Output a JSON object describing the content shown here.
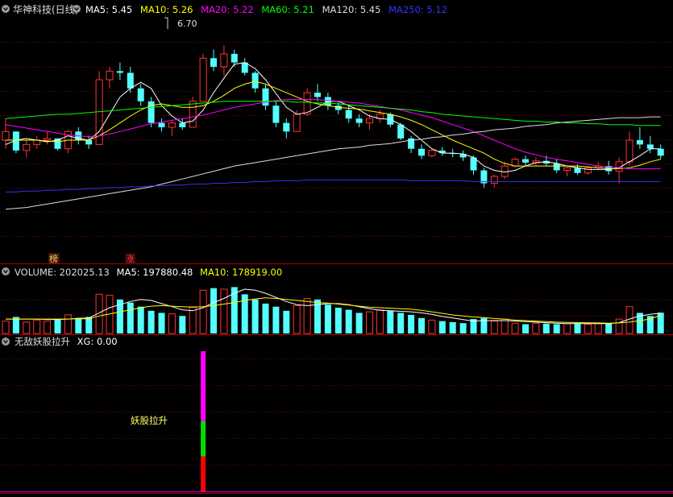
{
  "main": {
    "stock_title": "华神科技(日线)",
    "ma_labels": [
      {
        "text": "MA5: 5.45",
        "color": "#ffffff"
      },
      {
        "text": "MA10: 5.26",
        "color": "#ffff00"
      },
      {
        "text": "MA20: 5.22",
        "color": "#ff00ff"
      },
      {
        "text": "MA60: 5.21",
        "color": "#00ff00"
      },
      {
        "text": "MA120: 5.45",
        "color": "#dddddd"
      },
      {
        "text": "MA250: 5.12",
        "color": "#3333ff"
      }
    ],
    "high_label": "6.70",
    "markers": [
      {
        "text": "榜",
        "color": "#ffcc66"
      },
      {
        "text": "涨",
        "color": "#ff4444"
      }
    ]
  },
  "volume": {
    "labels": [
      {
        "text": "VOLUME: 202025.13",
        "color": "#dddddd"
      },
      {
        "text": "MA5: 197880.48",
        "color": "#ffffff"
      },
      {
        "text": "MA10: 178919.00",
        "color": "#ffff00"
      }
    ]
  },
  "indicator": {
    "labels": [
      {
        "text": "无敌妖股拉升",
        "color": "#dddddd"
      },
      {
        "text": "XG: 0.00",
        "color": "#ffffff"
      }
    ],
    "signal_text": "妖股拉升"
  },
  "colors": {
    "up": "#ff3333",
    "down": "#54ffff",
    "grid": "#8b0000",
    "border": "#aa0000"
  },
  "chart_data": [
    {
      "type": "candlestick",
      "title": "华神科技(日线)",
      "y_range": [
        4.2,
        7.0
      ],
      "candles": [
        [
          5.6,
          5.85,
          5.5,
          5.7
        ],
        [
          5.7,
          5.7,
          5.45,
          5.48
        ],
        [
          5.48,
          5.6,
          5.4,
          5.55
        ],
        [
          5.55,
          5.65,
          5.5,
          5.6
        ],
        [
          5.6,
          5.7,
          5.55,
          5.62
        ],
        [
          5.62,
          5.62,
          5.48,
          5.5
        ],
        [
          5.5,
          5.72,
          5.45,
          5.7
        ],
        [
          5.7,
          5.75,
          5.55,
          5.6
        ],
        [
          5.6,
          5.65,
          5.5,
          5.55
        ],
        [
          5.55,
          6.4,
          5.55,
          6.3
        ],
        [
          6.3,
          6.45,
          6.2,
          6.4
        ],
        [
          6.4,
          6.5,
          6.3,
          6.38
        ],
        [
          6.38,
          6.45,
          6.15,
          6.2
        ],
        [
          6.2,
          6.25,
          6.0,
          6.05
        ],
        [
          6.05,
          6.1,
          5.75,
          5.8
        ],
        [
          5.8,
          5.85,
          5.7,
          5.75
        ],
        [
          5.75,
          5.82,
          5.65,
          5.8
        ],
        [
          5.8,
          5.85,
          5.72,
          5.75
        ],
        [
          5.75,
          6.1,
          5.75,
          6.05
        ],
        [
          6.05,
          6.6,
          6.05,
          6.55
        ],
        [
          6.55,
          6.65,
          6.4,
          6.45
        ],
        [
          6.45,
          6.7,
          6.35,
          6.6
        ],
        [
          6.6,
          6.65,
          6.45,
          6.5
        ],
        [
          6.5,
          6.55,
          6.35,
          6.38
        ],
        [
          6.38,
          6.4,
          6.15,
          6.2
        ],
        [
          6.2,
          6.25,
          5.95,
          6.0
        ],
        [
          6.0,
          6.05,
          5.75,
          5.8
        ],
        [
          5.8,
          5.85,
          5.62,
          5.7
        ],
        [
          5.7,
          5.95,
          5.7,
          5.9
        ],
        [
          5.9,
          6.2,
          5.88,
          6.15
        ],
        [
          6.15,
          6.25,
          6.05,
          6.1
        ],
        [
          6.1,
          6.15,
          5.95,
          6.0
        ],
        [
          6.0,
          6.05,
          5.9,
          5.95
        ],
        [
          5.95,
          6.0,
          5.8,
          5.85
        ],
        [
          5.85,
          5.9,
          5.75,
          5.8
        ],
        [
          5.8,
          5.9,
          5.72,
          5.85
        ],
        [
          5.85,
          5.95,
          5.8,
          5.9
        ],
        [
          5.9,
          5.92,
          5.75,
          5.78
        ],
        [
          5.78,
          5.8,
          5.6,
          5.62
        ],
        [
          5.62,
          5.65,
          5.45,
          5.5
        ],
        [
          5.5,
          5.55,
          5.38,
          5.42
        ],
        [
          5.42,
          5.5,
          5.4,
          5.48
        ],
        [
          5.48,
          5.52,
          5.42,
          5.45
        ],
        [
          5.45,
          5.5,
          5.4,
          5.44
        ],
        [
          5.44,
          5.48,
          5.36,
          5.4
        ],
        [
          5.4,
          5.42,
          5.2,
          5.25
        ],
        [
          5.25,
          5.28,
          5.05,
          5.1
        ],
        [
          5.1,
          5.2,
          5.05,
          5.18
        ],
        [
          5.18,
          5.35,
          5.15,
          5.3
        ],
        [
          5.3,
          5.4,
          5.28,
          5.38
        ],
        [
          5.38,
          5.42,
          5.3,
          5.34
        ],
        [
          5.34,
          5.4,
          5.3,
          5.36
        ],
        [
          5.36,
          5.42,
          5.3,
          5.33
        ],
        [
          5.33,
          5.38,
          5.22,
          5.25
        ],
        [
          5.25,
          5.3,
          5.18,
          5.28
        ],
        [
          5.28,
          5.32,
          5.2,
          5.22
        ],
        [
          5.22,
          5.3,
          5.2,
          5.28
        ],
        [
          5.28,
          5.35,
          5.25,
          5.3
        ],
        [
          5.3,
          5.36,
          5.2,
          5.24
        ],
        [
          5.24,
          5.4,
          5.1,
          5.35
        ],
        [
          5.35,
          5.7,
          5.3,
          5.6
        ],
        [
          5.6,
          5.75,
          5.5,
          5.55
        ],
        [
          5.55,
          5.65,
          5.45,
          5.5
        ],
        [
          5.5,
          5.55,
          5.38,
          5.42
        ]
      ],
      "series": [
        {
          "name": "MA5",
          "color": "#ffffff",
          "values": [
            5.55,
            5.6,
            5.62,
            5.6,
            5.58,
            5.6,
            5.65,
            5.62,
            5.6,
            5.7,
            5.9,
            6.1,
            6.2,
            6.27,
            6.2,
            6.0,
            5.88,
            5.8,
            5.82,
            5.95,
            6.15,
            6.32,
            6.48,
            6.5,
            6.43,
            6.3,
            6.14,
            5.98,
            5.9,
            5.92,
            5.98,
            6.05,
            6.05,
            6.0,
            5.95,
            5.88,
            5.85,
            5.84,
            5.78,
            5.7,
            5.6,
            5.5,
            5.45,
            5.45,
            5.44,
            5.4,
            5.3,
            5.25,
            5.23,
            5.25,
            5.3,
            5.34,
            5.35,
            5.33,
            5.3,
            5.28,
            5.26,
            5.26,
            5.26,
            5.28,
            5.35,
            5.42,
            5.5,
            5.5
          ]
        },
        {
          "name": "MA10",
          "color": "#ffff00",
          "values": [
            5.6,
            5.6,
            5.6,
            5.6,
            5.59,
            5.58,
            5.6,
            5.6,
            5.6,
            5.65,
            5.72,
            5.8,
            5.88,
            5.95,
            6.0,
            6.02,
            6.0,
            5.98,
            5.98,
            6.0,
            6.05,
            6.12,
            6.2,
            6.25,
            6.28,
            6.25,
            6.2,
            6.15,
            6.1,
            6.05,
            6.02,
            6.0,
            5.98,
            5.97,
            5.96,
            5.94,
            5.92,
            5.9,
            5.87,
            5.83,
            5.78,
            5.72,
            5.66,
            5.6,
            5.55,
            5.5,
            5.45,
            5.38,
            5.33,
            5.3,
            5.3,
            5.3,
            5.3,
            5.3,
            5.3,
            5.3,
            5.29,
            5.28,
            5.27,
            5.27,
            5.28,
            5.31,
            5.35,
            5.38
          ]
        },
        {
          "name": "MA20",
          "color": "#ff00ff",
          "values": [
            5.78,
            5.76,
            5.74,
            5.72,
            5.7,
            5.68,
            5.66,
            5.65,
            5.64,
            5.65,
            5.67,
            5.7,
            5.73,
            5.76,
            5.79,
            5.81,
            5.83,
            5.85,
            5.87,
            5.89,
            5.92,
            5.95,
            5.98,
            6.0,
            6.02,
            6.04,
            6.06,
            6.07,
            6.07,
            6.07,
            6.07,
            6.06,
            6.05,
            6.04,
            6.03,
            6.01,
            5.99,
            5.97,
            5.95,
            5.92,
            5.89,
            5.86,
            5.82,
            5.78,
            5.74,
            5.7,
            5.65,
            5.6,
            5.55,
            5.5,
            5.46,
            5.43,
            5.4,
            5.38,
            5.36,
            5.34,
            5.32,
            5.3,
            5.29,
            5.28,
            5.27,
            5.27,
            5.27,
            5.27
          ]
        },
        {
          "name": "MA60",
          "color": "#00ff00",
          "values": [
            5.85,
            5.86,
            5.87,
            5.88,
            5.89,
            5.9,
            5.9,
            5.91,
            5.92,
            5.93,
            5.94,
            5.95,
            5.96,
            5.97,
            5.98,
            5.99,
            6.0,
            6.01,
            6.02,
            6.03,
            6.04,
            6.05,
            6.05,
            6.05,
            6.05,
            6.05,
            6.05,
            6.05,
            6.04,
            6.04,
            6.03,
            6.03,
            6.02,
            6.01,
            6.0,
            5.99,
            5.98,
            5.97,
            5.96,
            5.95,
            5.93,
            5.92,
            5.9,
            5.89,
            5.88,
            5.87,
            5.86,
            5.85,
            5.84,
            5.83,
            5.82,
            5.82,
            5.81,
            5.81,
            5.8,
            5.8,
            5.79,
            5.79,
            5.78,
            5.78,
            5.78,
            5.77,
            5.77,
            5.77
          ]
        },
        {
          "name": "MA120",
          "color": "#dddddd",
          "values": [
            4.8,
            4.81,
            4.82,
            4.84,
            4.86,
            4.88,
            4.9,
            4.92,
            4.94,
            4.96,
            4.98,
            5.0,
            5.02,
            5.04,
            5.06,
            5.09,
            5.12,
            5.15,
            5.18,
            5.21,
            5.24,
            5.27,
            5.3,
            5.32,
            5.34,
            5.36,
            5.38,
            5.4,
            5.42,
            5.44,
            5.46,
            5.48,
            5.5,
            5.51,
            5.52,
            5.54,
            5.55,
            5.56,
            5.58,
            5.6,
            5.61,
            5.63,
            5.64,
            5.66,
            5.67,
            5.69,
            5.7,
            5.72,
            5.73,
            5.74,
            5.76,
            5.77,
            5.78,
            5.8,
            5.81,
            5.82,
            5.83,
            5.84,
            5.85,
            5.86,
            5.86,
            5.86,
            5.87,
            5.87
          ]
        },
        {
          "name": "MA250",
          "color": "#3333ff",
          "values": [
            5.0,
            5.0,
            5.01,
            5.01,
            5.02,
            5.02,
            5.03,
            5.03,
            5.04,
            5.04,
            5.05,
            5.05,
            5.06,
            5.06,
            5.07,
            5.07,
            5.08,
            5.08,
            5.09,
            5.09,
            5.1,
            5.1,
            5.11,
            5.11,
            5.12,
            5.12,
            5.13,
            5.13,
            5.13,
            5.14,
            5.14,
            5.14,
            5.14,
            5.14,
            5.14,
            5.14,
            5.14,
            5.14,
            5.14,
            5.13,
            5.13,
            5.13,
            5.13,
            5.13,
            5.13,
            5.12,
            5.12,
            5.12,
            5.12,
            5.12,
            5.12,
            5.12,
            5.12,
            5.12,
            5.12,
            5.12,
            5.12,
            5.12,
            5.12,
            5.12,
            5.12,
            5.12,
            5.12,
            5.12
          ]
        }
      ]
    },
    {
      "type": "bar",
      "title": "VOLUME",
      "y_range": [
        0,
        500000
      ],
      "values": [
        120000,
        160000,
        110000,
        130000,
        120000,
        140000,
        180000,
        150000,
        160000,
        380000,
        370000,
        330000,
        300000,
        260000,
        220000,
        200000,
        190000,
        170000,
        260000,
        420000,
        440000,
        430000,
        450000,
        380000,
        330000,
        290000,
        260000,
        220000,
        270000,
        340000,
        330000,
        280000,
        250000,
        230000,
        200000,
        210000,
        230000,
        220000,
        200000,
        180000,
        150000,
        130000,
        120000,
        110000,
        100000,
        140000,
        150000,
        120000,
        140000,
        100000,
        90000,
        100000,
        95000,
        90000,
        95000,
        100000,
        90000,
        95000,
        100000,
        140000,
        260000,
        200000,
        170000,
        202025.13
      ],
      "series": [
        {
          "name": "MA5",
          "color": "#ffffff",
          "values": [
            140000,
            140000,
            140000,
            140000,
            136000,
            136000,
            140000,
            148000,
            150000,
            200000,
            250000,
            280000,
            310000,
            330000,
            320000,
            290000,
            260000,
            230000,
            220000,
            250000,
            300000,
            340000,
            390000,
            430000,
            420000,
            390000,
            350000,
            310000,
            280000,
            270000,
            280000,
            290000,
            290000,
            280000,
            260000,
            240000,
            225000,
            220000,
            215000,
            210000,
            200000,
            185000,
            165000,
            150000,
            135000,
            120000,
            125000,
            125000,
            125000,
            120000,
            115000,
            110000,
            105000,
            100000,
            95000,
            95000,
            95000,
            95000,
            95000,
            105000,
            140000,
            170000,
            185000,
            197880.48
          ]
        },
        {
          "name": "MA10",
          "color": "#ffff00",
          "values": [
            140000,
            140000,
            140000,
            140000,
            140000,
            140000,
            140000,
            142000,
            143000,
            170000,
            190000,
            210000,
            230000,
            250000,
            265000,
            270000,
            265000,
            260000,
            255000,
            260000,
            270000,
            285000,
            300000,
            320000,
            335000,
            345000,
            340000,
            330000,
            320000,
            310000,
            300000,
            295000,
            285000,
            275000,
            265000,
            255000,
            250000,
            245000,
            240000,
            235000,
            225000,
            210000,
            195000,
            180000,
            170000,
            160000,
            155000,
            145000,
            138000,
            130000,
            125000,
            120000,
            115000,
            110000,
            108000,
            106000,
            104000,
            102000,
            100000,
            102000,
            110000,
            125000,
            140000,
            178919.0
          ]
        }
      ]
    },
    {
      "type": "bar",
      "title": "无敌妖股拉升",
      "xg": 0.0,
      "signal_index": 19,
      "signal_segments": [
        {
          "color": "#ff0000",
          "from": 0,
          "to": 0.25
        },
        {
          "color": "#00dd00",
          "from": 0.25,
          "to": 0.5
        },
        {
          "color": "#ff00ff",
          "from": 0.5,
          "to": 1.0
        }
      ]
    }
  ]
}
